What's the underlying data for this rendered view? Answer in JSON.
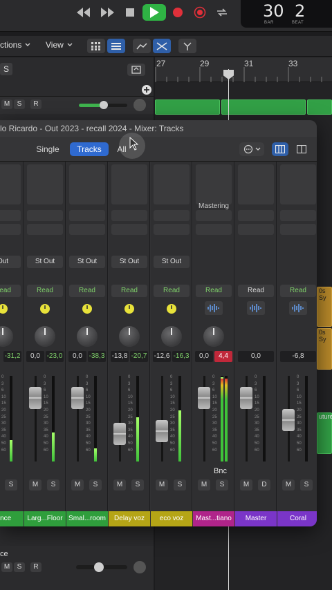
{
  "transport": {
    "bar": "30",
    "beat": "2",
    "bar_caption": "BAR",
    "beat_caption": "BEAT",
    "play_color": "#2fb344"
  },
  "toolbar": {
    "functions_label": "ctions",
    "view_label": "View"
  },
  "track_header": {
    "s_label": "S",
    "m_label": "M",
    "s2_label": "S",
    "r_label": "R"
  },
  "ruler": {
    "marks": [
      "27",
      "29",
      "31",
      "33"
    ]
  },
  "mixer": {
    "title": "lo Ricardo - Out 2023 - recall 2024 - Mixer: Tracks",
    "view_single": "Single",
    "view_tracks": "Tracks",
    "view_all": "All",
    "mastering_label": "Mastering",
    "bnc_label": "Bnc",
    "strips": [
      {
        "output": "Out",
        "read": "Read",
        "left_val": "",
        "right_val": "-31,2",
        "name": ".ence",
        "name_color": "#2f9e3c",
        "meter": 0.25
      },
      {
        "output": "St Out",
        "read": "Read",
        "left_val": "0,0",
        "right_val": "-23,0",
        "name": "Larg...Floor",
        "name_color": "#2f9e3c",
        "meter": 0.34
      },
      {
        "output": "St Out",
        "read": "Read",
        "left_val": "0,0",
        "right_val": "-38,3",
        "name": "Smal...room",
        "name_color": "#2f9e3c",
        "meter": 0.15
      },
      {
        "output": "St Out",
        "read": "Read",
        "left_val": "-13,8",
        "right_val": "-20,7",
        "name": "Delay voz",
        "name_color": "#b5a516",
        "meter": 0.52
      },
      {
        "output": "St Out",
        "read": "Read",
        "left_val": "-12,6",
        "right_val": "-16,3",
        "name": "eco voz",
        "name_color": "#b5a516",
        "meter": 0.6
      },
      {
        "output": "",
        "read": "Read",
        "left_val": "0,0",
        "right_val": "4,4",
        "name": "Mast...tiano",
        "name_color": "#b0248a",
        "meter": 0.98
      },
      {
        "output": "",
        "read": "Read",
        "left_val": "0,0",
        "right_val": "",
        "name": "Master",
        "name_color": "#7a35c8",
        "meter": 0
      },
      {
        "output": "",
        "read": "Read",
        "left_val": "-6,8",
        "right_val": "",
        "name": "Coral",
        "name_color": "#7a35c8",
        "meter": 0
      }
    ],
    "fader_scale": [
      "0",
      "3",
      "6",
      "10",
      "15",
      "20",
      "25",
      "30",
      "35",
      "40",
      "50",
      "60"
    ],
    "m_label": "M",
    "s_label": "S",
    "d_label": "D"
  },
  "bottom_track": {
    "name": "ce",
    "m_label": "M",
    "s_label": "S",
    "r_label": "R"
  },
  "arrange_labels": {
    "region_a": "0s Sy",
    "region_b": "0s Sy",
    "region_c": "uture"
  }
}
